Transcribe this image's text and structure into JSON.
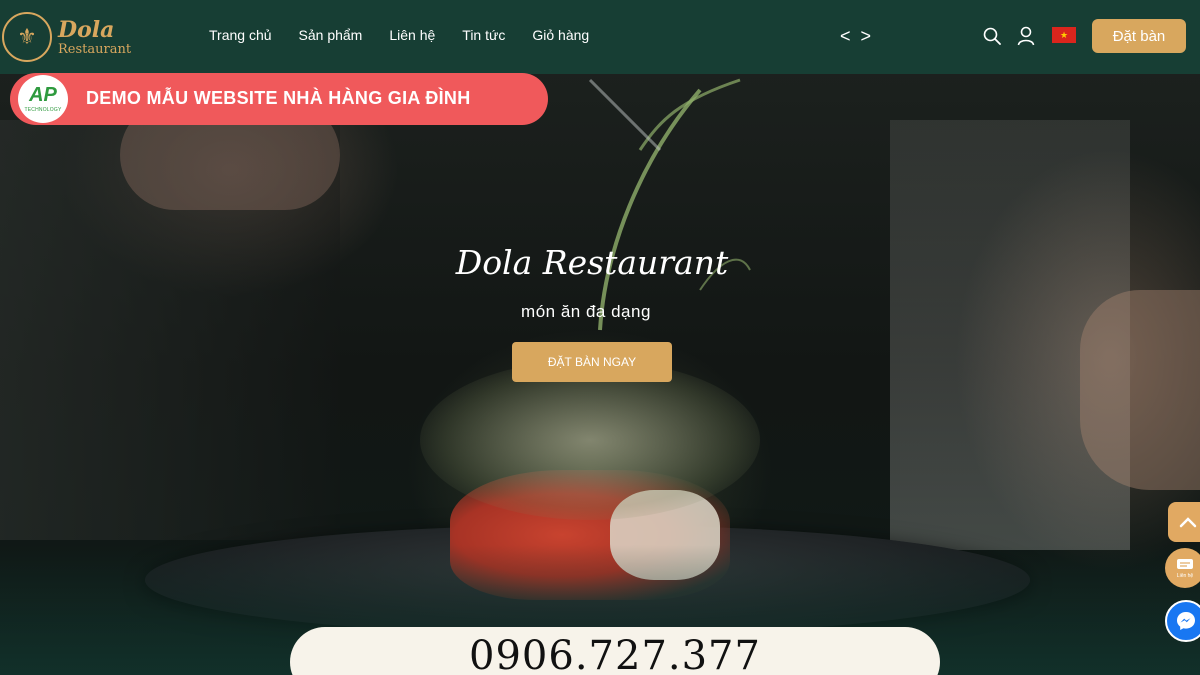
{
  "header": {
    "logo": {
      "name": "Dola",
      "sub": "Restaurant"
    },
    "nav": [
      {
        "label": "Trang chủ"
      },
      {
        "label": "Sản phẩm"
      },
      {
        "label": "Liên hệ"
      },
      {
        "label": "Tin tức"
      },
      {
        "label": "Giỏ hàng"
      }
    ],
    "arrows": {
      "prev": "<",
      "next": ">"
    },
    "book_label": "Đặt bàn",
    "icons": [
      "search-icon",
      "user-icon",
      "vietnam-flag-icon"
    ]
  },
  "banner": {
    "logo_mark": "AP",
    "logo_sub": "TECHNOLOGY",
    "text": "DEMO MẪU WEBSITE NHÀ HÀNG GIA ĐÌNH"
  },
  "hero": {
    "title": "Dola Restaurant",
    "subtitle": "món ăn đa dạng",
    "button": "ĐẶT BÀN NGAY"
  },
  "floating": {
    "contact_label": "Liên hệ",
    "icons": [
      "chevron-up-icon",
      "contact-icon",
      "messenger-icon"
    ]
  },
  "phone": "0906.727.377",
  "colors": {
    "header_bg": "#173e34",
    "accent_gold": "#d8a75e",
    "banner_red": "#f0595b",
    "messenger_blue": "#1877f2"
  }
}
